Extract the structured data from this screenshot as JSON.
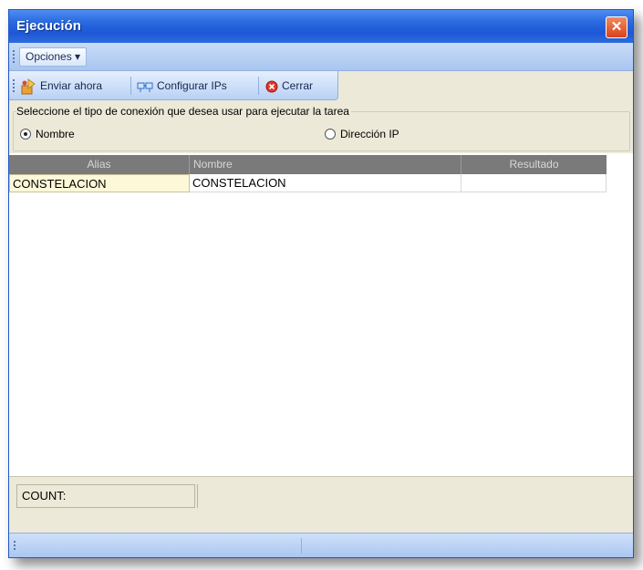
{
  "window": {
    "title": "Ejecución",
    "close_glyph": "✕"
  },
  "menu": {
    "options_label": "Opciones",
    "options_arrow": "▾"
  },
  "toolbar": {
    "send_now_label": "Enviar ahora",
    "configure_ips_label": "Configurar IPs",
    "close_label": "Cerrar"
  },
  "connection": {
    "legend": "Seleccione el tipo de conexión que desea usar para ejecutar la tarea",
    "option_name_label": "Nombre",
    "option_ip_label": "Dirección IP",
    "selected": "Nombre"
  },
  "grid": {
    "columns": [
      "Alias",
      "Nombre",
      "Resultado"
    ],
    "rows": [
      {
        "alias": "CONSTELACION",
        "nombre": "CONSTELACION",
        "resultado": ""
      }
    ]
  },
  "status": {
    "count_label": "COUNT:"
  },
  "colors": {
    "title_bar": "#2a6be0",
    "grid_header": "#7a7a7a",
    "selected_cell": "#fdf8d8",
    "window_body": "#ece9d8"
  }
}
